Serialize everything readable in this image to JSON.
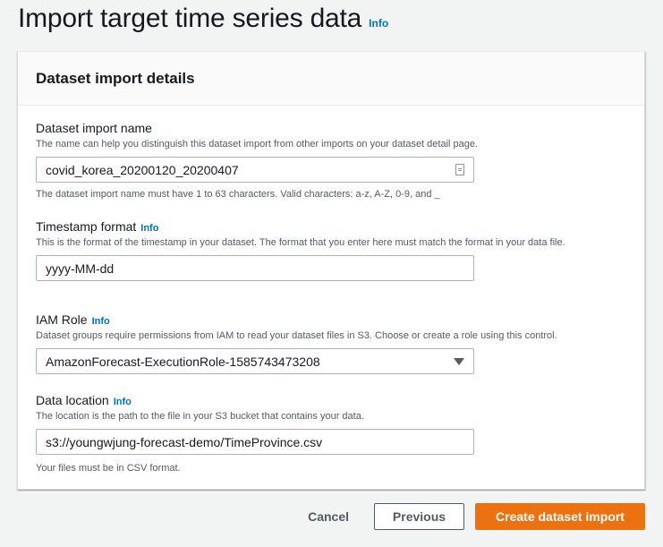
{
  "page": {
    "title": "Import target time series data",
    "info": "Info"
  },
  "card": {
    "title": "Dataset import details"
  },
  "fields": {
    "import_name": {
      "label": "Dataset import name",
      "description": "The name can help you distinguish this dataset import from other imports on your dataset detail page.",
      "value": "covid_korea_20200120_20200407",
      "constraint": "The dataset import name must have 1 to 63 characters. Valid characters: a-z, A-Z, 0-9, and _",
      "icon": "autofill-card-icon"
    },
    "timestamp_format": {
      "label": "Timestamp format",
      "info": "Info",
      "description": "This is the format of the timestamp in your dataset. The format that you enter here must match the format in your data file.",
      "value": "yyyy-MM-dd"
    },
    "iam_role": {
      "label": "IAM Role",
      "info": "Info",
      "description": "Dataset groups require permissions from IAM to read your dataset files in S3. Choose or create a role using this control.",
      "selected": "AmazonForecast-ExecutionRole-1585743473208"
    },
    "data_location": {
      "label": "Data location",
      "info": "Info",
      "description": "The location is the path to the file in your S3 bucket that contains your data.",
      "value": "s3://youngwjung-forecast-demo/TimeProvince.csv",
      "constraint": "Your files must be in CSV format."
    }
  },
  "actions": {
    "cancel": "Cancel",
    "previous": "Previous",
    "create": "Create dataset import"
  },
  "colors": {
    "primary": "#ec7211",
    "link": "#0073bb",
    "background": "#f2f3f3"
  }
}
